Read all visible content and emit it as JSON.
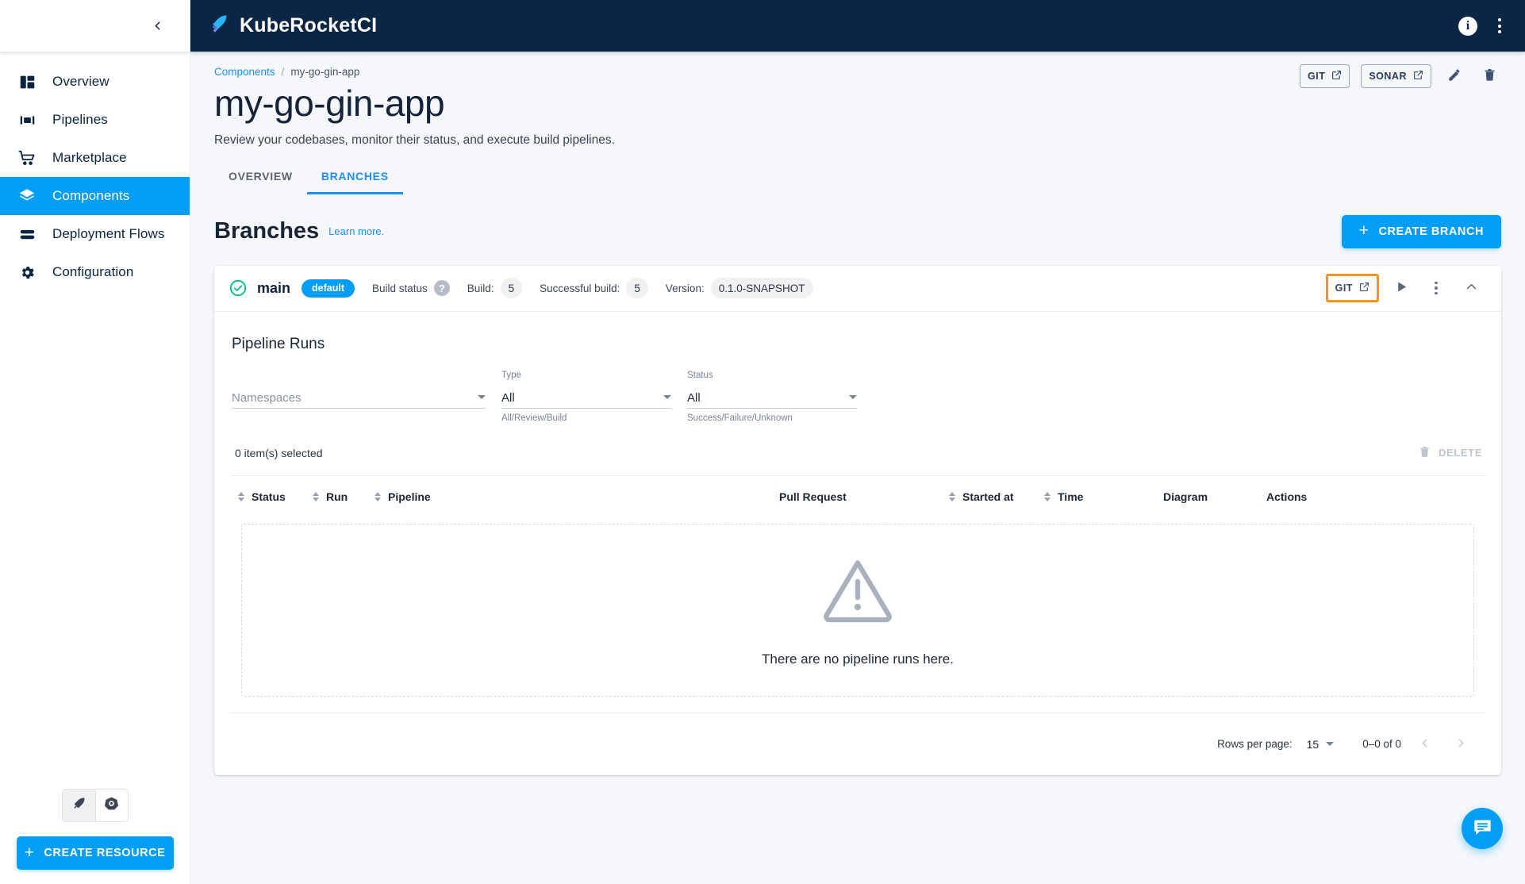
{
  "topbar": {
    "brand": "KubeRocketCI",
    "logo_icon": "rocket-icon",
    "info_icon": "info-icon",
    "menu_icon": "kebab-menu-icon"
  },
  "sidebar": {
    "collapse_icon": "chevron-left-icon",
    "items": [
      {
        "label": "Overview",
        "icon": "dashboard-icon",
        "active": false
      },
      {
        "label": "Pipelines",
        "icon": "pipelines-icon",
        "active": false
      },
      {
        "label": "Marketplace",
        "icon": "cart-icon",
        "active": false
      },
      {
        "label": "Components",
        "icon": "layers-icon",
        "active": true
      },
      {
        "label": "Deployment Flows",
        "icon": "stack-icon",
        "active": false
      },
      {
        "label": "Configuration",
        "icon": "gear-icon",
        "active": false
      }
    ],
    "cluster_toggle": [
      {
        "icon": "kuberocketci-icon",
        "selected": true
      },
      {
        "icon": "kubernetes-icon",
        "selected": false
      }
    ],
    "create_resource_label": "CREATE RESOURCE"
  },
  "page": {
    "breadcrumb_root": "Components",
    "breadcrumb_sep": "/",
    "breadcrumb_current": "my-go-gin-app",
    "title": "my-go-gin-app",
    "subtitle": "Review your codebases, monitor their status, and execute build pipelines.",
    "actions": {
      "git_label": "GIT",
      "sonar_label": "SONAR",
      "edit_icon": "pencil-icon",
      "delete_icon": "trash-icon",
      "external_icon": "external-link-icon"
    },
    "tabs": [
      {
        "label": "OVERVIEW",
        "active": false
      },
      {
        "label": "BRANCHES",
        "active": true
      }
    ]
  },
  "branches_section": {
    "title": "Branches",
    "learn_more": "Learn more.",
    "create_branch_label": "CREATE BRANCH"
  },
  "branch": {
    "status_icon": "check-circle-icon",
    "name": "main",
    "default_badge": "default",
    "build_status_label": "Build status",
    "help_icon": "question-mark-icon",
    "build_label": "Build:",
    "build_value": "5",
    "successful_build_label": "Successful build:",
    "successful_build_value": "5",
    "version_label": "Version:",
    "version_value": "0.1.0-SNAPSHOT",
    "git_label": "GIT",
    "git_highlighted": true,
    "highlight_color": "#f7941d",
    "run_icon": "play-icon",
    "more_icon": "kebab-menu-icon",
    "collapse_icon": "chevron-up-icon"
  },
  "runs": {
    "title": "Pipeline Runs",
    "filters": [
      {
        "label": "",
        "value": "Namespaces",
        "placeholder": true,
        "help": ""
      },
      {
        "label": "Type",
        "value": "All",
        "placeholder": false,
        "help": "All/Review/Build"
      },
      {
        "label": "Status",
        "value": "All",
        "placeholder": false,
        "help": "Success/Failure/Unknown"
      }
    ],
    "selected_text": "0 item(s) selected",
    "delete_label": "DELETE",
    "columns": [
      {
        "label": "Status",
        "sortable": true
      },
      {
        "label": "Run",
        "sortable": true
      },
      {
        "label": "Pipeline",
        "sortable": true
      },
      {
        "label": "Pull Request",
        "sortable": false
      },
      {
        "label": "Started at",
        "sortable": true
      },
      {
        "label": "Time",
        "sortable": true
      },
      {
        "label": "Diagram",
        "sortable": false
      },
      {
        "label": "Actions",
        "sortable": false
      }
    ],
    "empty_icon": "warning-triangle-icon",
    "empty_text": "There are no pipeline runs here.",
    "rows_per_page_label": "Rows per page:",
    "rows_per_page_value": "15",
    "range_text": "0–0 of 0",
    "prev_icon": "chevron-left-icon"
  },
  "fab": {
    "icon": "chat-icon"
  },
  "colors": {
    "accent": "#029ef5",
    "topbar": "#0b2545",
    "highlight": "#f7941d",
    "success": "#00c07f"
  }
}
